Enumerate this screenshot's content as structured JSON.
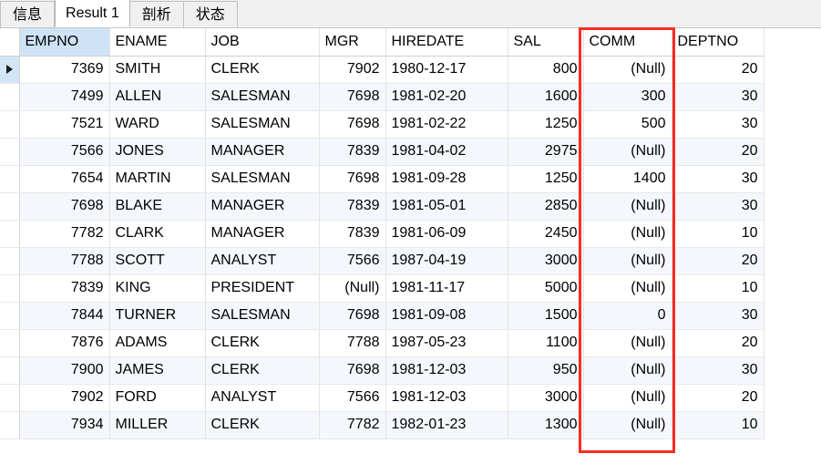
{
  "tabs": [
    {
      "label": "信息",
      "active": false
    },
    {
      "label": "Result 1",
      "active": true
    },
    {
      "label": "剖析",
      "active": false
    },
    {
      "label": "状态",
      "active": false
    }
  ],
  "grid": {
    "selected_column": "EMPNO",
    "current_row_index": 0,
    "null_display": "(Null)",
    "columns": [
      {
        "key": "EMPNO",
        "label": "EMPNO",
        "align": "right"
      },
      {
        "key": "ENAME",
        "label": "ENAME",
        "align": "left"
      },
      {
        "key": "JOB",
        "label": "JOB",
        "align": "left"
      },
      {
        "key": "MGR",
        "label": "MGR",
        "align": "right"
      },
      {
        "key": "HIREDATE",
        "label": "HIREDATE",
        "align": "left"
      },
      {
        "key": "SAL",
        "label": "SAL",
        "align": "right"
      },
      {
        "key": "COMM",
        "label": "COMM",
        "align": "right"
      },
      {
        "key": "DEPTNO",
        "label": "DEPTNO",
        "align": "right"
      }
    ],
    "rows": [
      {
        "EMPNO": "7369",
        "ENAME": "SMITH",
        "JOB": "CLERK",
        "MGR": "7902",
        "HIREDATE": "1980-12-17",
        "SAL": "800",
        "COMM": "(Null)",
        "DEPTNO": "20"
      },
      {
        "EMPNO": "7499",
        "ENAME": "ALLEN",
        "JOB": "SALESMAN",
        "MGR": "7698",
        "HIREDATE": "1981-02-20",
        "SAL": "1600",
        "COMM": "300",
        "DEPTNO": "30"
      },
      {
        "EMPNO": "7521",
        "ENAME": "WARD",
        "JOB": "SALESMAN",
        "MGR": "7698",
        "HIREDATE": "1981-02-22",
        "SAL": "1250",
        "COMM": "500",
        "DEPTNO": "30"
      },
      {
        "EMPNO": "7566",
        "ENAME": "JONES",
        "JOB": "MANAGER",
        "MGR": "7839",
        "HIREDATE": "1981-04-02",
        "SAL": "2975",
        "COMM": "(Null)",
        "DEPTNO": "20"
      },
      {
        "EMPNO": "7654",
        "ENAME": "MARTIN",
        "JOB": "SALESMAN",
        "MGR": "7698",
        "HIREDATE": "1981-09-28",
        "SAL": "1250",
        "COMM": "1400",
        "DEPTNO": "30"
      },
      {
        "EMPNO": "7698",
        "ENAME": "BLAKE",
        "JOB": "MANAGER",
        "MGR": "7839",
        "HIREDATE": "1981-05-01",
        "SAL": "2850",
        "COMM": "(Null)",
        "DEPTNO": "30"
      },
      {
        "EMPNO": "7782",
        "ENAME": "CLARK",
        "JOB": "MANAGER",
        "MGR": "7839",
        "HIREDATE": "1981-06-09",
        "SAL": "2450",
        "COMM": "(Null)",
        "DEPTNO": "10"
      },
      {
        "EMPNO": "7788",
        "ENAME": "SCOTT",
        "JOB": "ANALYST",
        "MGR": "7566",
        "HIREDATE": "1987-04-19",
        "SAL": "3000",
        "COMM": "(Null)",
        "DEPTNO": "20"
      },
      {
        "EMPNO": "7839",
        "ENAME": "KING",
        "JOB": "PRESIDENT",
        "MGR": "(Null)",
        "HIREDATE": "1981-11-17",
        "SAL": "5000",
        "COMM": "(Null)",
        "DEPTNO": "10"
      },
      {
        "EMPNO": "7844",
        "ENAME": "TURNER",
        "JOB": "SALESMAN",
        "MGR": "7698",
        "HIREDATE": "1981-09-08",
        "SAL": "1500",
        "COMM": "0",
        "DEPTNO": "30"
      },
      {
        "EMPNO": "7876",
        "ENAME": "ADAMS",
        "JOB": "CLERK",
        "MGR": "7788",
        "HIREDATE": "1987-05-23",
        "SAL": "1100",
        "COMM": "(Null)",
        "DEPTNO": "20"
      },
      {
        "EMPNO": "7900",
        "ENAME": "JAMES",
        "JOB": "CLERK",
        "MGR": "7698",
        "HIREDATE": "1981-12-03",
        "SAL": "950",
        "COMM": "(Null)",
        "DEPTNO": "30"
      },
      {
        "EMPNO": "7902",
        "ENAME": "FORD",
        "JOB": "ANALYST",
        "MGR": "7566",
        "HIREDATE": "1981-12-03",
        "SAL": "3000",
        "COMM": "(Null)",
        "DEPTNO": "20"
      },
      {
        "EMPNO": "7934",
        "ENAME": "MILLER",
        "JOB": "CLERK",
        "MGR": "7782",
        "HIREDATE": "1982-01-23",
        "SAL": "1300",
        "COMM": "(Null)",
        "DEPTNO": "10"
      }
    ]
  },
  "annotation": {
    "shape": "rectangle",
    "color": "#fb2c23",
    "highlights_column": "COMM"
  }
}
